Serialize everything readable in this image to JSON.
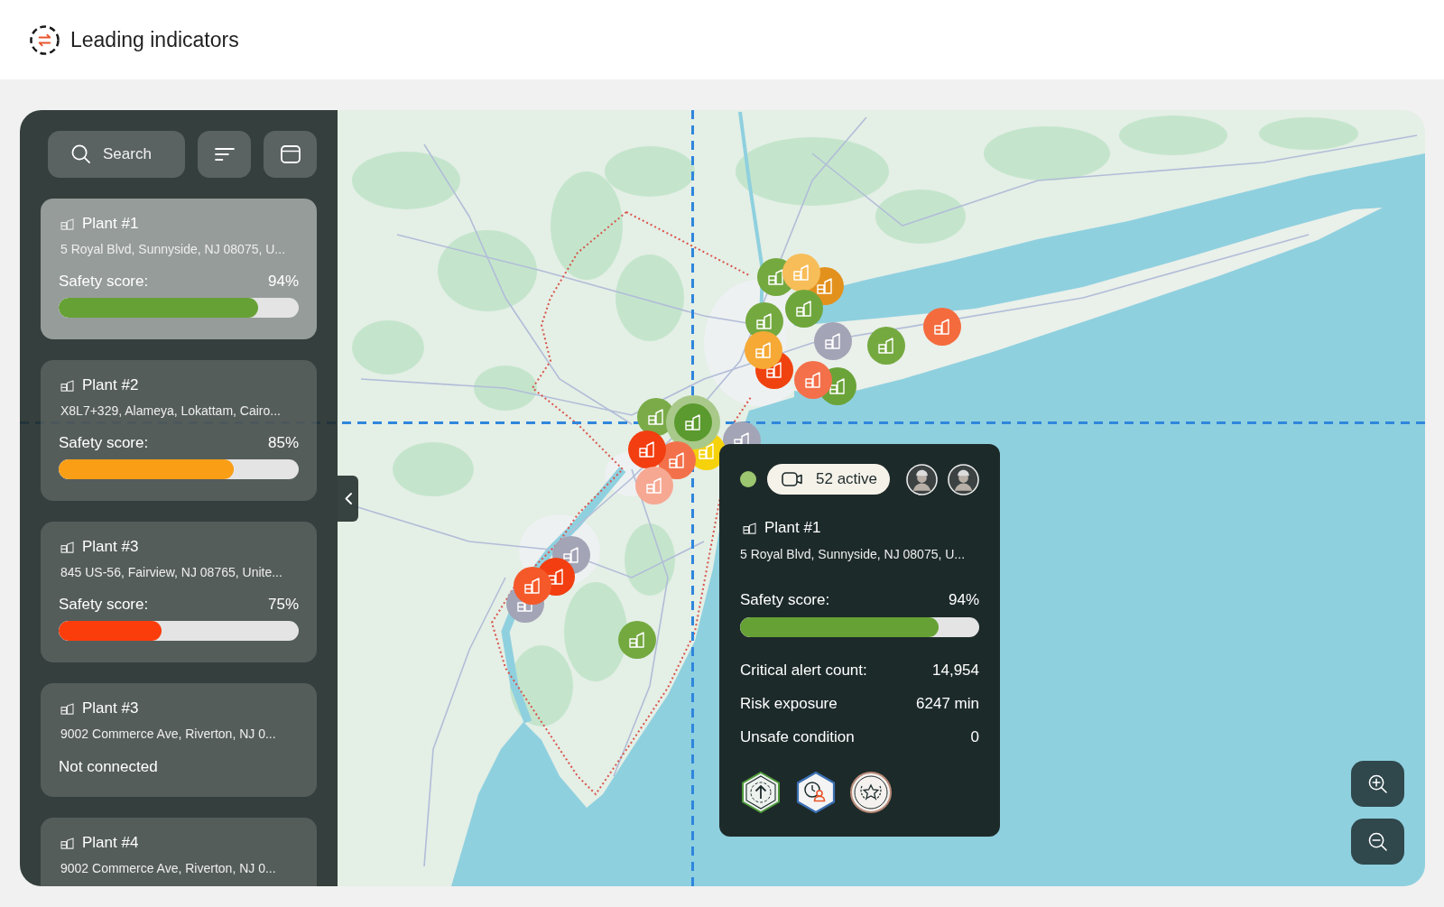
{
  "header": {
    "title": "Leading indicators"
  },
  "sidebar": {
    "search": {
      "placeholder": "Search"
    },
    "plants": [
      {
        "kind": "score",
        "name": "Plant #1",
        "address": "5 Royal Blvd, Sunnyside, NJ 08075, U...",
        "selected": true,
        "score_label": "Safety score:",
        "score": "94%",
        "level": 0.83,
        "color": "#66a135"
      },
      {
        "kind": "score",
        "name": "Plant #2",
        "address": "X8L7+329, Alameya, Lokattam, Cairo...",
        "selected": false,
        "score_label": "Safety score:",
        "score": "85%",
        "level": 0.73,
        "color": "#fa9e16"
      },
      {
        "kind": "score",
        "name": "Plant #3",
        "address": "845 US-56, Fairview, NJ 08765, Unite...",
        "selected": false,
        "score_label": "Safety score:",
        "score": "75%",
        "level": 0.43,
        "color": "#fb3d0c"
      },
      {
        "kind": "status",
        "name": "Plant #3",
        "address": "9002 Commerce Ave, Riverton, NJ 0...",
        "selected": false,
        "status": "Not connected"
      },
      {
        "kind": "summary",
        "name": "Plant #4",
        "address": "9002 Commerce Ave, Riverton, NJ 0...",
        "selected": false
      }
    ]
  },
  "map": {
    "markers": [
      {
        "color": "#74a940",
        "selected": false
      },
      {
        "color": "#e3911d",
        "selected": false
      },
      {
        "color": "#f7bd58",
        "selected": false
      },
      {
        "color": "#6fa63c",
        "selected": false
      },
      {
        "color": "#74a940",
        "selected": false
      },
      {
        "color": "#a3a4b6",
        "selected": false
      },
      {
        "color": "#74a940",
        "selected": false
      },
      {
        "color": "#f46b3d",
        "selected": false
      },
      {
        "color": "#6aa338",
        "selected": false
      },
      {
        "color": "#f0420f",
        "selected": false
      },
      {
        "color": "#f6a935",
        "selected": false
      },
      {
        "color": "#f3704a",
        "selected": false
      },
      {
        "color": "#a3a4b6",
        "selected": false
      },
      {
        "color": "#f5d20c",
        "selected": false
      },
      {
        "color": "#7aab48",
        "selected": false
      },
      {
        "color": "#5b9a2e",
        "selected": true
      },
      {
        "color": "#f3714a",
        "selected": false
      },
      {
        "color": "#f23e10",
        "selected": false
      },
      {
        "color": "#f6a893",
        "selected": false
      },
      {
        "color": "#a3a4b6",
        "selected": false
      },
      {
        "color": "#f23e10",
        "selected": false
      },
      {
        "color": "#a3a4b6",
        "selected": false
      },
      {
        "color": "#f5592a",
        "selected": false
      },
      {
        "color": "#74a940",
        "selected": false
      }
    ]
  },
  "popup": {
    "online": true,
    "cameras": "52 active",
    "people": [
      {
        "kind": "avatar"
      },
      {
        "kind": "avatar"
      }
    ],
    "name": "Plant #1",
    "address": "5 Royal Blvd, Sunnyside, NJ 08075, U...",
    "score_label": "Safety score:",
    "score": "94%",
    "level": 0.83,
    "metrics": [
      {
        "label": "Critical alert count:",
        "value": "14,954"
      },
      {
        "label": "Risk exposure",
        "value": "6247 min"
      },
      {
        "label": "Unsafe condition",
        "value": "0"
      }
    ],
    "badges": [
      {
        "kind": "level-up"
      },
      {
        "kind": "schedule"
      },
      {
        "kind": "award"
      }
    ]
  }
}
